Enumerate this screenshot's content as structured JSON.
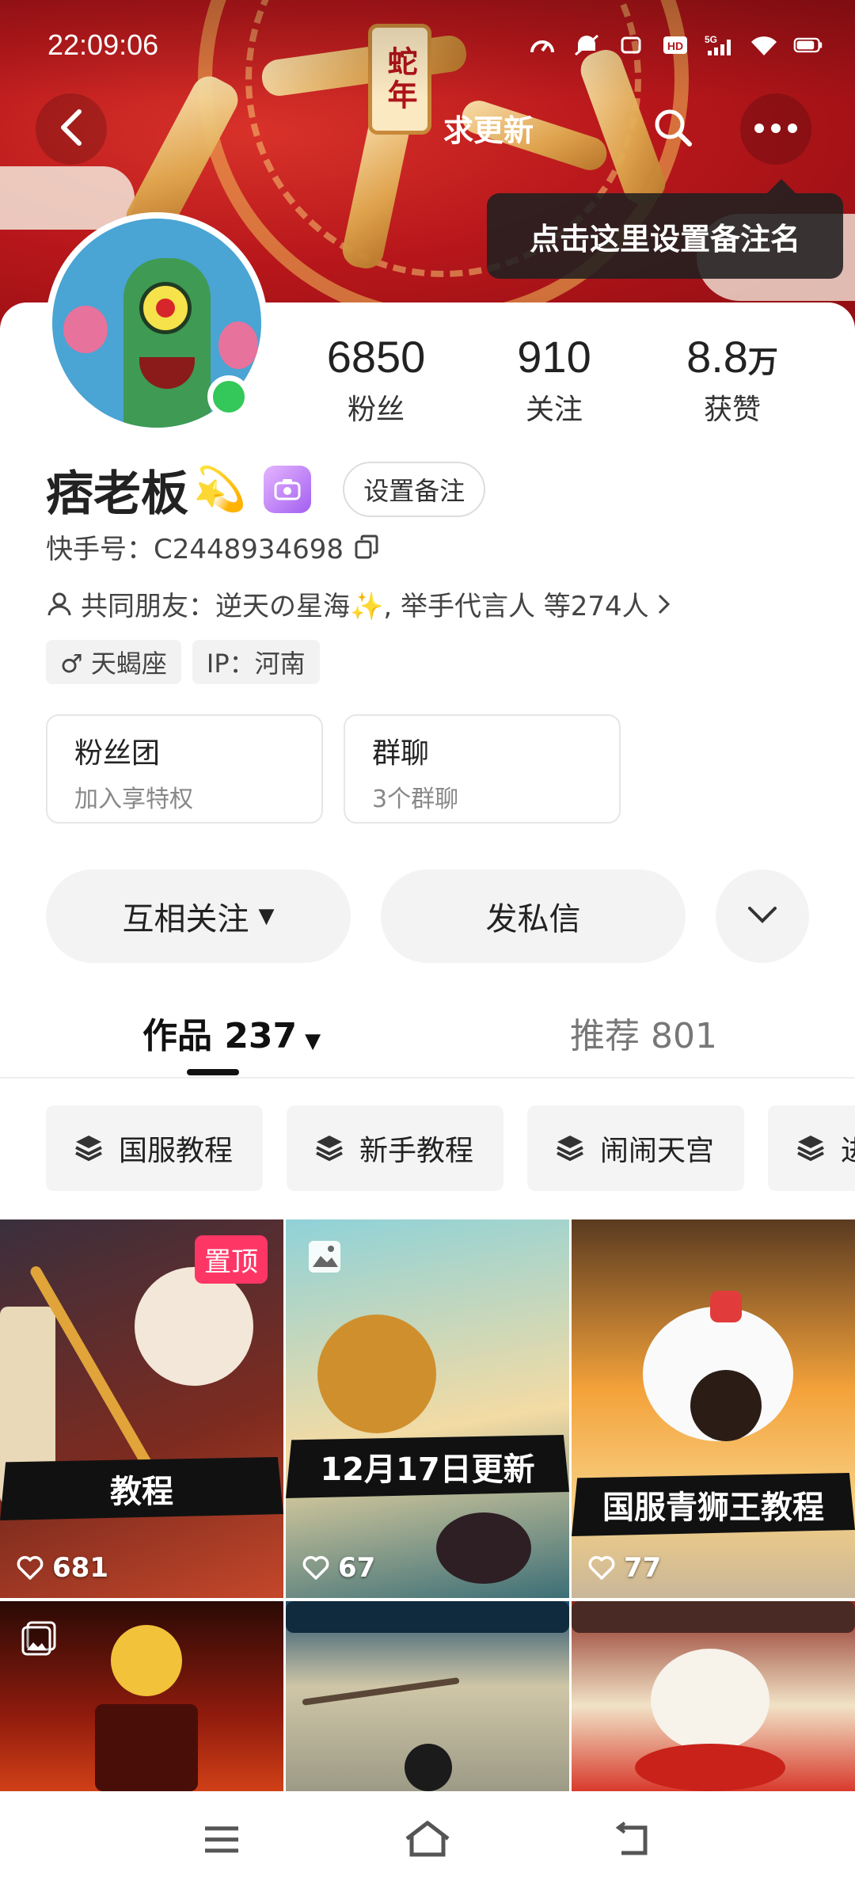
{
  "status_bar": {
    "time": "22:09:06",
    "icons": [
      "speed-meter-icon",
      "mute-icon",
      "wifi-calling-icon",
      "hd-icon",
      "signal-5g-icon",
      "wifi-icon",
      "battery-icon"
    ]
  },
  "nav": {
    "title": "求更新",
    "tooltip": "点击这里设置备注名"
  },
  "banner": {
    "seal_text": "蛇年"
  },
  "profile": {
    "stats": [
      {
        "num": "6850",
        "unit": "",
        "label": "粉丝"
      },
      {
        "num": "910",
        "unit": "",
        "label": "关注"
      },
      {
        "num": "8.8",
        "unit": "万",
        "label": "获赞"
      }
    ],
    "name": "痞老板",
    "name_emoji": "💫",
    "remark_button": "设置备注",
    "kwai_id": "快手号：C2448934698",
    "mutual_friends": "共同朋友：逆天の星海✨, 举手代言人 等274人",
    "tags": [
      "♂ 天蝎座",
      "IP：河南"
    ],
    "cards": [
      {
        "title": "粉丝团",
        "sub": "加入享特权"
      },
      {
        "title": "群聊",
        "sub": "3个群聊"
      }
    ],
    "actions": {
      "follow": "互相关注",
      "message": "发私信"
    }
  },
  "tabs": {
    "works": "作品 237",
    "recommend": "推荐 801"
  },
  "collections": [
    "国服教程",
    "新手教程",
    "闹闹天宫",
    "进"
  ],
  "grid": [
    {
      "caption": "教程",
      "likes": "681",
      "pinned": "置顶"
    },
    {
      "caption": "12月17日更新",
      "likes": "67"
    },
    {
      "caption": "国服青狮王教程",
      "likes": "77"
    },
    {
      "caption": "",
      "likes": ""
    },
    {
      "caption": "",
      "likes": ""
    },
    {
      "caption": "",
      "likes": ""
    }
  ],
  "colors": {
    "online": "#34c759",
    "pin_badge": "#fe3666"
  }
}
